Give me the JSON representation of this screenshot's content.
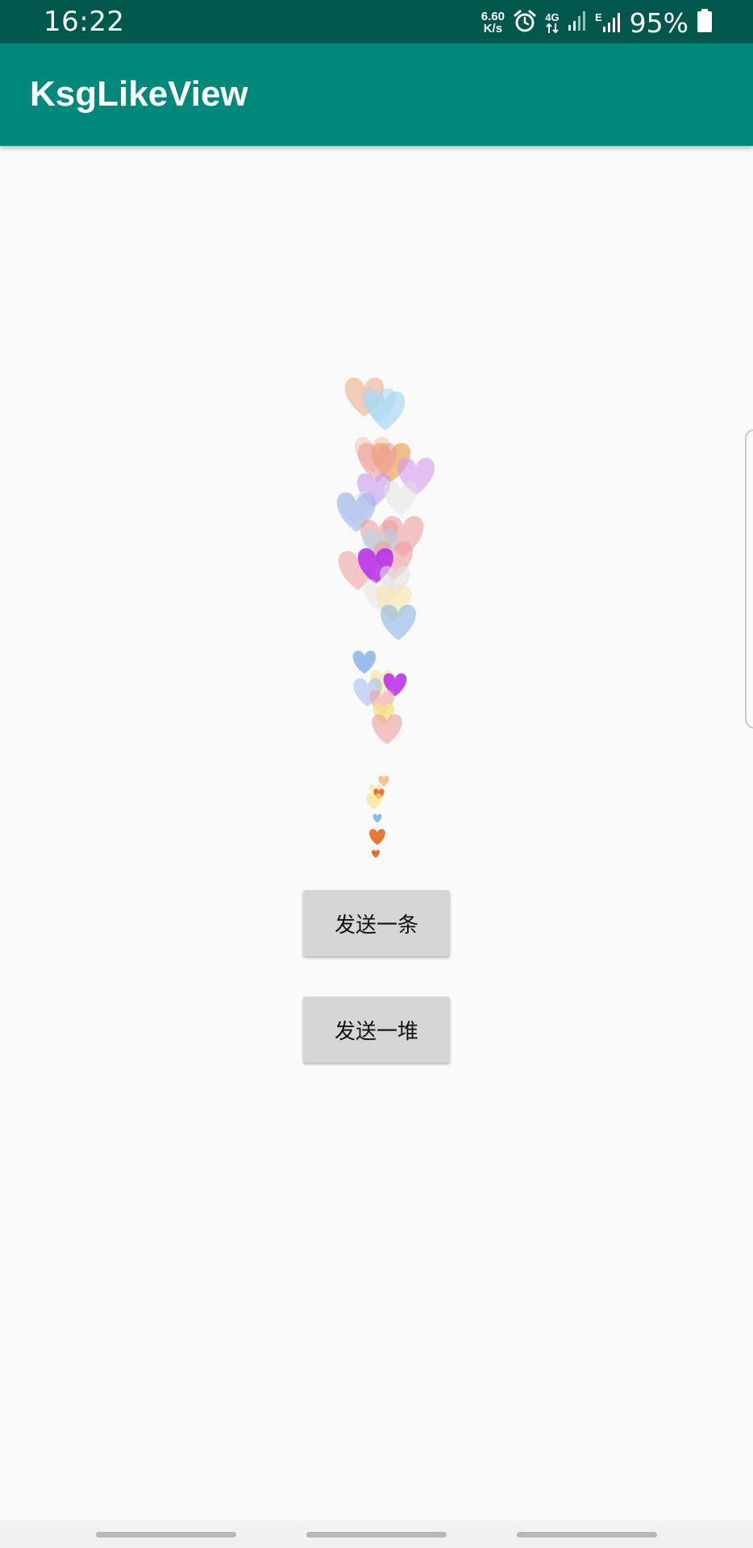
{
  "status_bar": {
    "time": "16:22",
    "net_speed_value": "6.60",
    "net_speed_unit": "K/s",
    "alarm_icon": "alarm-icon",
    "network_4g": "4G",
    "network_e": "E",
    "battery_percent": "95%"
  },
  "app_bar": {
    "title": "KsgLikeView",
    "color": "#00897b"
  },
  "buttons": {
    "send_one": "发送一条",
    "send_many": "发送一堆"
  },
  "heart_colors": {
    "peach": "#f0b89a",
    "sky": "#a9d9f0",
    "orange": "#eea862",
    "rose": "#ee9c9c",
    "violet": "#d79aee",
    "lilac": "#c79af0",
    "blue": "#9fb8ee",
    "gray": "#e3e3e3",
    "purple": "#b52cea",
    "cream": "#f6e3a8",
    "steel": "#8ab4e6",
    "yellow": "#f6e488",
    "orange_deep": "#e06a1e",
    "sky_small": "#7fb2e8"
  }
}
